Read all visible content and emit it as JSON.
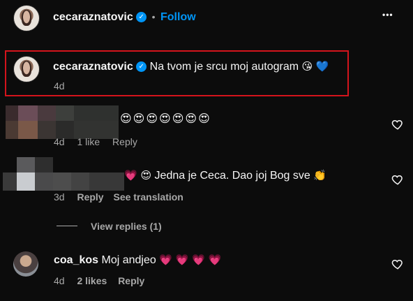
{
  "header": {
    "username": "cecaraznatovic",
    "follow_label": "Follow",
    "separator": "•",
    "more_label": "•••"
  },
  "caption": {
    "username": "cecaraznatovic",
    "text": "Na tvom je srcu moj autogram",
    "emojis": "😘 💙",
    "time": "4d",
    "highlight_color": "#d4141c"
  },
  "comments": [
    {
      "text": "😍😍😍😍😍😍😍",
      "time": "4d",
      "likes": "1 like",
      "reply": "Reply"
    },
    {
      "text_emoji_prefix": "💗 😍",
      "text": "Jedna je Ceca. Dao joj Bog sve",
      "text_emoji_suffix": "👏",
      "time": "3d",
      "reply": "Reply",
      "translate": "See translation",
      "view_replies": "View replies (1)"
    },
    {
      "username": "coa_kos",
      "text": "Moj andjeo",
      "emojis": "💗 💗 💗 💗",
      "time": "4d",
      "likes": "2 likes",
      "reply": "Reply"
    }
  ],
  "colors": {
    "accent": "#0095f6",
    "heart": "#ff3366"
  }
}
